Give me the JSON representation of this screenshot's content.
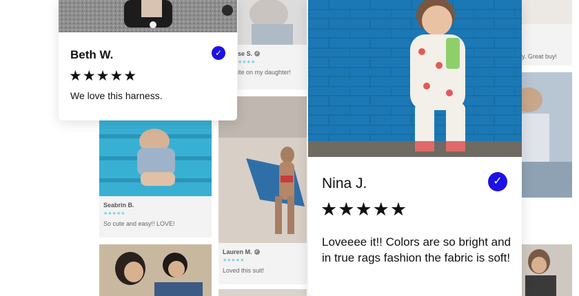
{
  "featured_reviews": [
    {
      "name": "Beth W.",
      "stars": "★★★★★",
      "text": "We love this harness.",
      "verified_icon": "check-icon"
    },
    {
      "name": "Nina J.",
      "stars": "★★★★★",
      "text": "Loveeee it!! Colors are so bright and in true rags fashion the fabric is soft!",
      "verified_icon": "check-icon"
    }
  ],
  "grid_reviews": [
    {
      "name": "Seabrin B.",
      "stars": "★★★★★",
      "text": "So cute and easy!! LOVE!"
    },
    {
      "name": "Lauren M.",
      "stars": "★★★★★",
      "text": "Loved this suit!"
    },
    {
      "name": "se S.",
      "stars": "★★★★",
      "text": "ite on my daughter!"
    },
    {
      "name": "",
      "stars": "",
      "text": "y. Great buy!"
    }
  ],
  "colors": {
    "accent": "#1d11e6",
    "star_light": "#6fd0e6",
    "brick": "#1b78b5"
  }
}
